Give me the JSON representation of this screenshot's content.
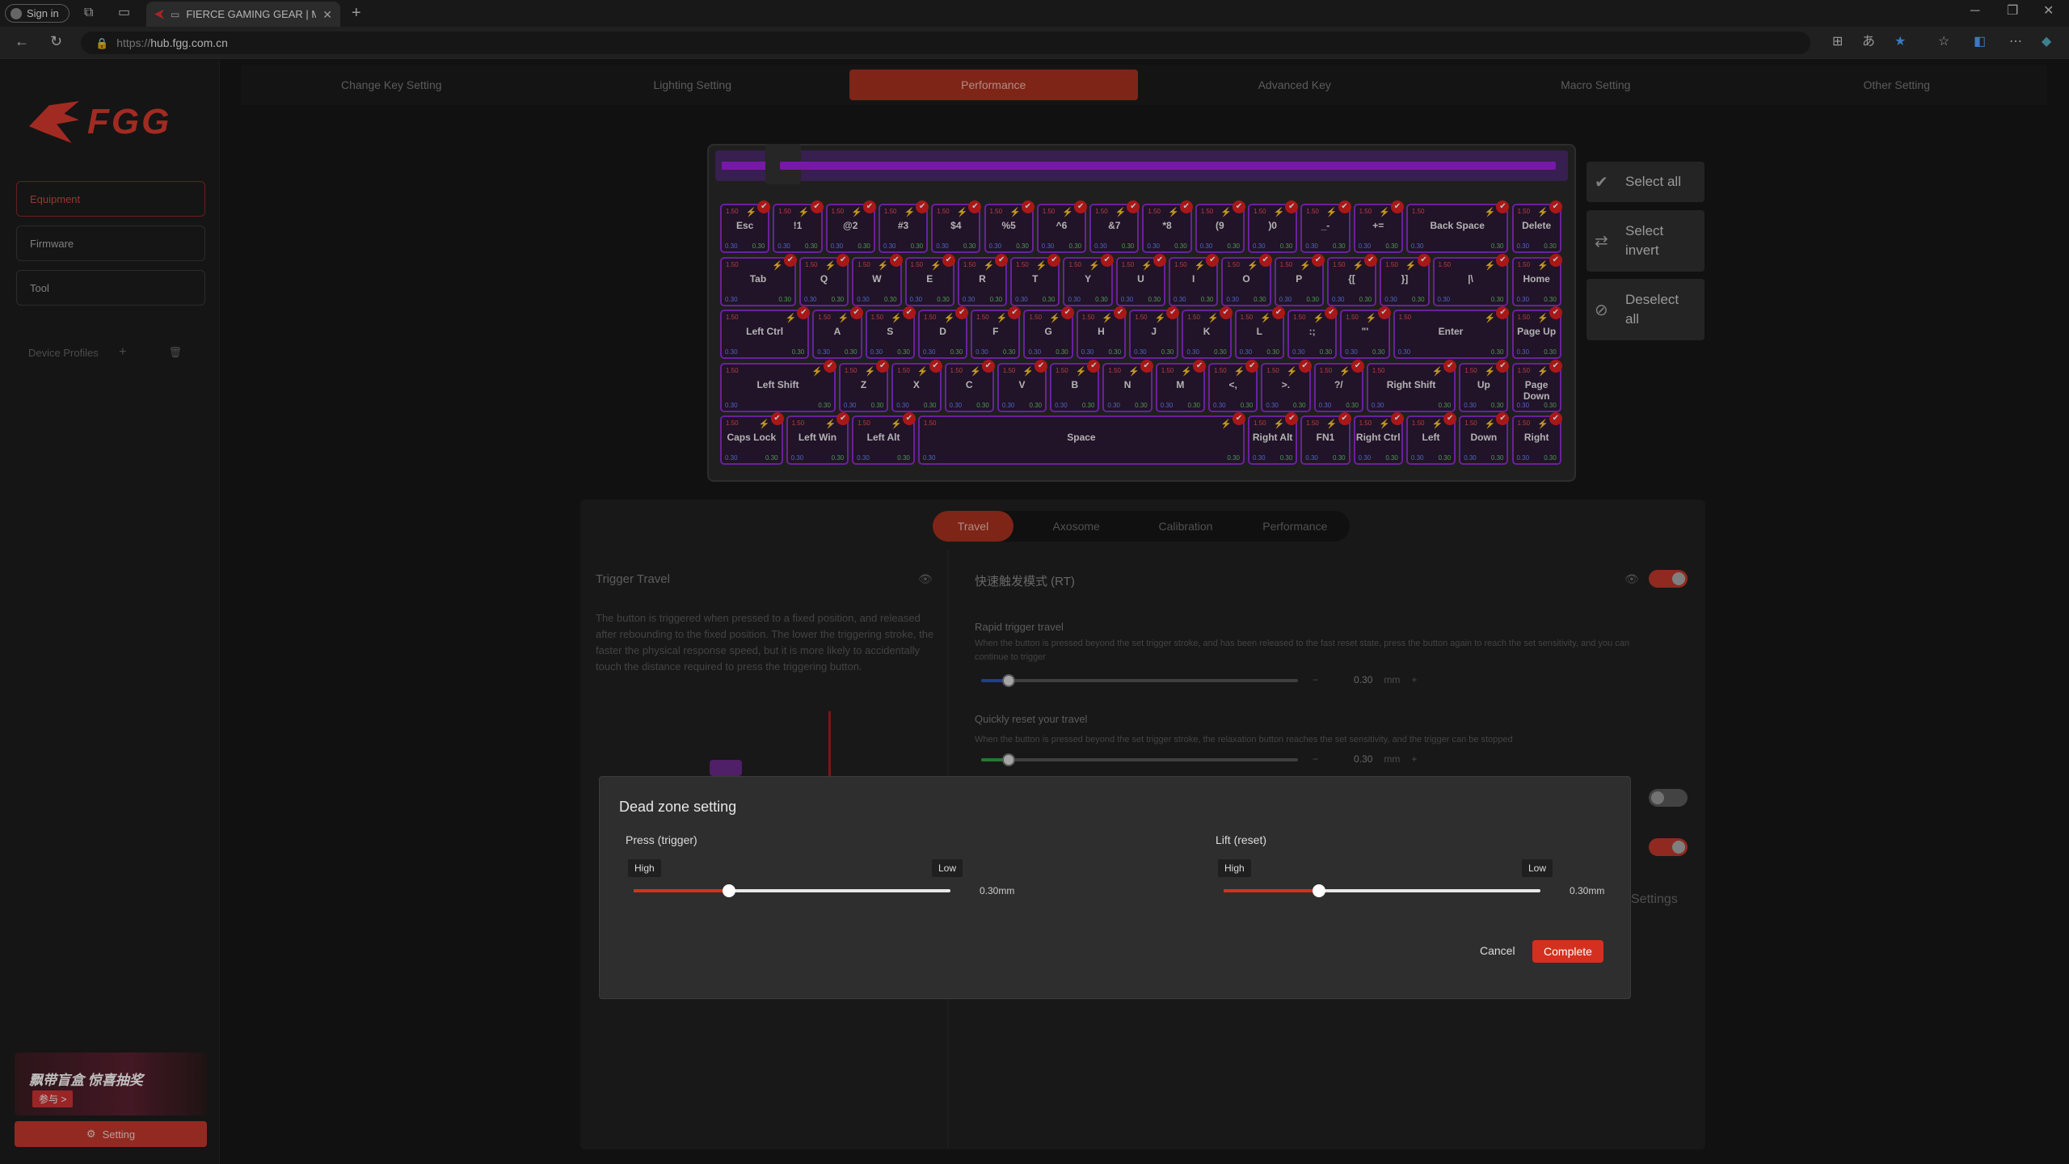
{
  "browser": {
    "signin": "Sign in",
    "tab_title": "FIERCE GAMING GEAR | MA",
    "url_scheme": "https://",
    "url_host": "hub.fgg.com.cn"
  },
  "sidebar": {
    "logo": "FGG",
    "items": [
      {
        "label": "Equipment",
        "active": true
      },
      {
        "label": "Firmware",
        "active": false
      },
      {
        "label": "Tool",
        "active": false
      }
    ],
    "device_profiles": "Device Profiles",
    "banner_title": "飘带盲盒 惊喜抽奖",
    "banner_cta": "参与 >",
    "setting": "Setting"
  },
  "top_tabs": [
    {
      "label": "Change Key Setting",
      "active": false
    },
    {
      "label": "Lighting Setting",
      "active": false
    },
    {
      "label": "Performance",
      "active": true
    },
    {
      "label": "Advanced Key",
      "active": false
    },
    {
      "label": "Macro Setting",
      "active": false
    },
    {
      "label": "Other Setting",
      "active": false
    }
  ],
  "keyboard": {
    "top_value": "1.50",
    "bottom_left": "0.30",
    "bottom_right": "0.30",
    "rows": [
      [
        {
          "l": "Esc",
          "w": 1
        },
        {
          "l": "!1",
          "w": 1
        },
        {
          "l": "@2",
          "w": 1
        },
        {
          "l": "#3",
          "w": 1
        },
        {
          "l": "$4",
          "w": 1
        },
        {
          "l": "%5",
          "w": 1
        },
        {
          "l": "^6",
          "w": 1
        },
        {
          "l": "&7",
          "w": 1
        },
        {
          "l": "*8",
          "w": 1
        },
        {
          "l": "(9",
          "w": 1
        },
        {
          "l": ")0",
          "w": 1
        },
        {
          "l": "_-",
          "w": 1
        },
        {
          "l": "+=",
          "w": 1
        },
        {
          "l": "Back Space",
          "w": 2
        },
        {
          "l": "Delete",
          "w": 1
        }
      ],
      [
        {
          "l": "Tab",
          "w": 1.5
        },
        {
          "l": "Q",
          "w": 1
        },
        {
          "l": "W",
          "w": 1
        },
        {
          "l": "E",
          "w": 1
        },
        {
          "l": "R",
          "w": 1
        },
        {
          "l": "T",
          "w": 1
        },
        {
          "l": "Y",
          "w": 1
        },
        {
          "l": "U",
          "w": 1
        },
        {
          "l": "I",
          "w": 1
        },
        {
          "l": "O",
          "w": 1
        },
        {
          "l": "P",
          "w": 1
        },
        {
          "l": "{[",
          "w": 1
        },
        {
          "l": "}]",
          "w": 1
        },
        {
          "l": "|\\",
          "w": 1.5
        },
        {
          "l": "Home",
          "w": 1
        }
      ],
      [
        {
          "l": "Left Ctrl",
          "w": 1.75
        },
        {
          "l": "A",
          "w": 1
        },
        {
          "l": "S",
          "w": 1
        },
        {
          "l": "D",
          "w": 1
        },
        {
          "l": "F",
          "w": 1
        },
        {
          "l": "G",
          "w": 1
        },
        {
          "l": "H",
          "w": 1
        },
        {
          "l": "J",
          "w": 1
        },
        {
          "l": "K",
          "w": 1
        },
        {
          "l": "L",
          "w": 1
        },
        {
          "l": ":;",
          "w": 1
        },
        {
          "l": "\"'",
          "w": 1
        },
        {
          "l": "Enter",
          "w": 2.25
        },
        {
          "l": "Page Up",
          "w": 1
        }
      ],
      [
        {
          "l": "Left Shift",
          "w": 2.25
        },
        {
          "l": "Z",
          "w": 1
        },
        {
          "l": "X",
          "w": 1
        },
        {
          "l": "C",
          "w": 1
        },
        {
          "l": "V",
          "w": 1
        },
        {
          "l": "B",
          "w": 1
        },
        {
          "l": "N",
          "w": 1
        },
        {
          "l": "M",
          "w": 1
        },
        {
          "l": "<,",
          "w": 1
        },
        {
          "l": ">.",
          "w": 1
        },
        {
          "l": "?/",
          "w": 1
        },
        {
          "l": "Right Shift",
          "w": 1.75
        },
        {
          "l": "Up",
          "w": 1
        },
        {
          "l": "Page Down",
          "w": 1
        }
      ],
      [
        {
          "l": "Caps Lock",
          "w": 1.25
        },
        {
          "l": "Left Win",
          "w": 1.25
        },
        {
          "l": "Left Alt",
          "w": 1.25
        },
        {
          "l": "Space",
          "w": 6.25
        },
        {
          "l": "Right Alt",
          "w": 1
        },
        {
          "l": "FN1",
          "w": 1
        },
        {
          "l": "Right Ctrl",
          "w": 1
        },
        {
          "l": "Left",
          "w": 1
        },
        {
          "l": "Down",
          "w": 1
        },
        {
          "l": "Right",
          "w": 1
        }
      ]
    ]
  },
  "selection": {
    "select_all": "Select all",
    "select_invert": "Select invert",
    "deselect_all": "Deselect all"
  },
  "sub_tabs": [
    {
      "label": "Travel",
      "active": true
    },
    {
      "label": "Axosome",
      "active": false
    },
    {
      "label": "Calibration",
      "active": false
    },
    {
      "label": "Performance",
      "active": false
    }
  ],
  "trigger": {
    "title": "Trigger Travel",
    "desc": "The button is triggered when pressed to a fixed position, and released after rebounding to the fixed position. The lower the triggering stroke, the faster the physical response speed, but it is more likely to accidentally touch the distance required to press the triggering button."
  },
  "rt": {
    "title": "快速触发模式 (RT)",
    "rapid_title": "Rapid trigger travel",
    "rapid_desc": "When the button is pressed beyond the set trigger stroke, and has been released to the fast reset state, press the button again to reach the set sensitivity, and you can continue to trigger",
    "rapid_value": "0.30",
    "unit": "mm",
    "reset_title": "Quickly reset your travel",
    "reset_desc": "When the button is pressed beyond the set trigger stroke, the relaxation button reaches the set sensitivity, and the trigger can be stopped",
    "reset_value": "0.30",
    "settings_label": "Settings"
  },
  "modal": {
    "title": "Dead zone setting",
    "press_label": "Press (trigger)",
    "lift_label": "Lift (reset)",
    "high": "High",
    "low": "Low",
    "press_value": "0.30mm",
    "lift_value": "0.30mm",
    "press_level": 0.3,
    "lift_level": 0.3,
    "cancel": "Cancel",
    "complete": "Complete"
  },
  "colors": {
    "accent": "#c3382c",
    "key_border": "#8c2cd0"
  }
}
